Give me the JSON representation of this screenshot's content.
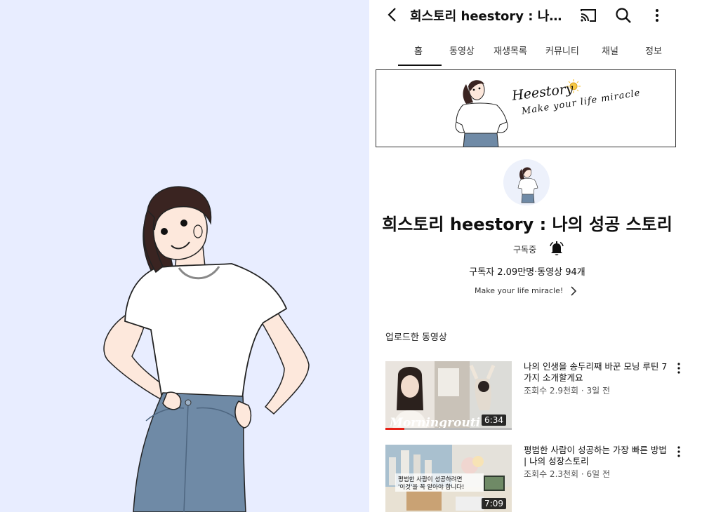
{
  "header": {
    "title": "희스토리 heestory : 나의..."
  },
  "tabs": [
    {
      "label": "홈"
    },
    {
      "label": "동영상"
    },
    {
      "label": "재생목록"
    },
    {
      "label": "커뮤니티"
    },
    {
      "label": "채널"
    },
    {
      "label": "정보"
    }
  ],
  "banner": {
    "line1": "Heestory",
    "line2": "Make your life miracle"
  },
  "channel": {
    "name": "희스토리 heestory : 나의 성공 스토리",
    "subscribed_label": "구독중",
    "stats": "구독자 2.09만명·동영상 94개",
    "description": "Make your life miracle!"
  },
  "uploads": {
    "section_title": "업로드한 동영상",
    "videos": [
      {
        "title": "나의 인생을 송두리째 바꾼 모닝 루틴 7가지 소개할게요",
        "meta": "조회수 2.9천회 · 3일 전",
        "duration": "6:34",
        "thumb_text": "Morningrouti",
        "progress": 0.15
      },
      {
        "title": "평범한 사람이 성공하는 가장 빠른 방법 | 나의 성장스토리",
        "meta": "조회수 2.3천회 · 6일 전",
        "duration": "7:09",
        "thumb_line1": "평범한 사람이 성공하려면",
        "thumb_line2": "'이것'을 꼭 알아야 합니다!"
      }
    ]
  },
  "colors": {
    "left_bg": "#e8edff",
    "jeans": "#6f8aa6",
    "hair": "#3a2421",
    "progress_red": "#e62117"
  }
}
